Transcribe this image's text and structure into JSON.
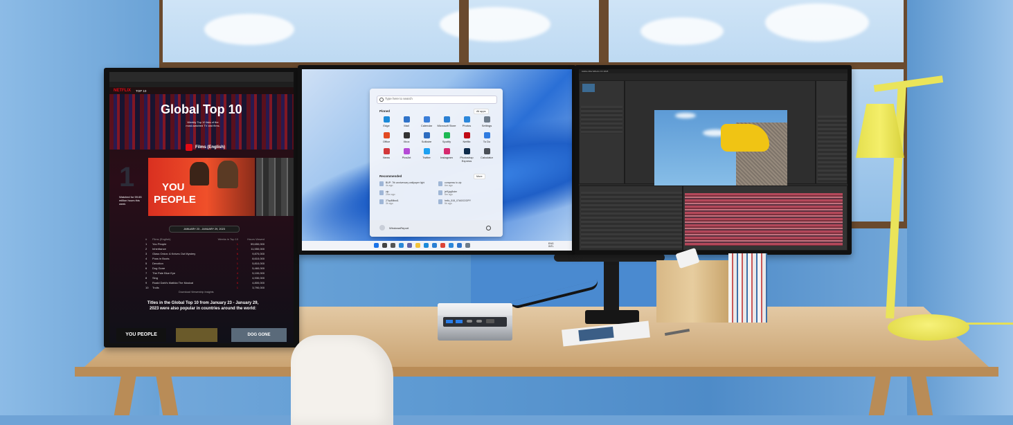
{
  "scene": {
    "accent_colors": {
      "wall": "#5f9bd3",
      "desk": "#d2b083",
      "lamp": "#f4ef6a",
      "netflix_red": "#e50914"
    }
  },
  "left_monitor": {
    "brand": "NETFLIX",
    "nav_label": "TOP 10",
    "hero_title": "Global Top 10",
    "hero_subtitle": "Weekly Top 10 lists of the most-watched TV and films.",
    "section_title": "Films (English)",
    "rank_number": "1",
    "featured_title_line1": "YOU",
    "featured_title_line2": "PEOPLE",
    "watched_note": "Watched for 59.65 million hours this week",
    "date_range": "JANUARY 23 - JANUARY 29, 2023",
    "list_headers": [
      "#",
      "Films (English)",
      "Weeks in Top 10",
      "Hours Viewed"
    ],
    "list": [
      {
        "rank": "1",
        "title": "You People",
        "weeks": "1",
        "hours": "59,650,000"
      },
      {
        "rank": "2",
        "title": "Inheritance",
        "weeks": "1",
        "hours": "11,550,000"
      },
      {
        "rank": "3",
        "title": "Glass Onion: A Knives Out Mystery",
        "weeks": "6",
        "hours": "9,870,000"
      },
      {
        "rank": "4",
        "title": "Puss in Boots",
        "weeks": "1",
        "hours": "8,610,000"
      },
      {
        "rank": "5",
        "title": "Devotion",
        "weeks": "1",
        "hours": "5,810,000"
      },
      {
        "rank": "6",
        "title": "Dog Gone",
        "weeks": "2",
        "hours": "5,460,000"
      },
      {
        "rank": "7",
        "title": "The Pale Blue Eye",
        "weeks": "4",
        "hours": "5,100,000"
      },
      {
        "rank": "8",
        "title": "Sing",
        "weeks": "2",
        "hours": "4,930,000"
      },
      {
        "rank": "9",
        "title": "Roald Dahl's Matilda The Musical",
        "weeks": "6",
        "hours": "4,800,000"
      },
      {
        "rank": "10",
        "title": "Trolls",
        "weeks": "1",
        "hours": "3,790,000"
      }
    ],
    "download_label": "Download Viewership Insights",
    "footer_text": "Titles in the Global Top 10 from January 23 - January 29, 2023 were also popular in countries around the world:",
    "bottom_tiles": [
      "YOU PEOPLE",
      "DOG GONE"
    ]
  },
  "center_monitor": {
    "search_placeholder": "Type here to search",
    "pinned_label": "Pinned",
    "all_apps_label": "All apps",
    "pinned_apps": [
      {
        "name": "Edge",
        "color": "#1b8ad9"
      },
      {
        "name": "Mail",
        "color": "#2f73c9"
      },
      {
        "name": "Calendar",
        "color": "#3a7ed8"
      },
      {
        "name": "Microsoft Store",
        "color": "#2a7fd3"
      },
      {
        "name": "Photos",
        "color": "#2c87db"
      },
      {
        "name": "Settings",
        "color": "#6d7b8a"
      },
      {
        "name": "Office",
        "color": "#e24a22"
      },
      {
        "name": "Xbox",
        "color": "#333333"
      },
      {
        "name": "Solitaire",
        "color": "#2d6cc0"
      },
      {
        "name": "Spotify",
        "color": "#1db954"
      },
      {
        "name": "Netflix",
        "color": "#c00a14"
      },
      {
        "name": "To Do",
        "color": "#2f7be0"
      },
      {
        "name": "News",
        "color": "#d2383b"
      },
      {
        "name": "PicsArt",
        "color": "#b54ad6"
      },
      {
        "name": "Twitter",
        "color": "#1da1f2"
      },
      {
        "name": "Instagram",
        "color": "#d6296f"
      },
      {
        "name": "Photoshop Express",
        "color": "#0d2a4a"
      },
      {
        "name": "Calculator",
        "color": "#4a4f57"
      }
    ],
    "recommended_label": "Recommended",
    "more_label": "More",
    "recommended": [
      {
        "name": "BUP: 7th anniversary wallpaper light",
        "time": "4s ago"
      },
      {
        "name": "compress to zip",
        "time": "6m ago"
      },
      {
        "name": "zip",
        "time": "29m ago"
      },
      {
        "name": "jeff jpg8ster",
        "time": "5m ago"
      },
      {
        "name": "2TopBillwd1",
        "time": "3h ago"
      },
      {
        "name": "hello_515_07A0GOOPY",
        "time": "5h ago"
      }
    ],
    "user_name": "WindowsReport",
    "tray_lang": "ENG",
    "tray_region": "INTL"
  },
  "right_monitor": {
    "app_title": "Adobe After Effects CC 2018"
  }
}
